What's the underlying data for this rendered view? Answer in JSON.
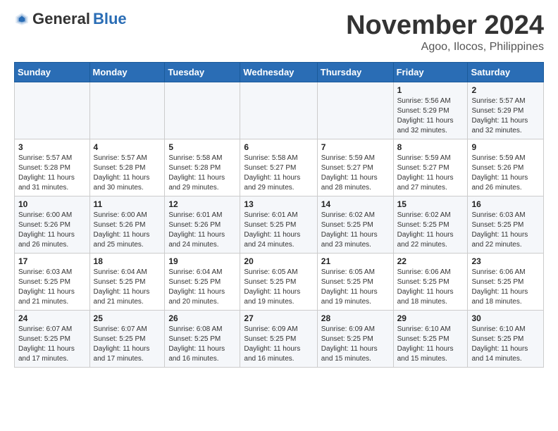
{
  "header": {
    "logo_general": "General",
    "logo_blue": "Blue",
    "month_title": "November 2024",
    "location": "Agoo, Ilocos, Philippines"
  },
  "weekdays": [
    "Sunday",
    "Monday",
    "Tuesday",
    "Wednesday",
    "Thursday",
    "Friday",
    "Saturday"
  ],
  "weeks": [
    [
      {
        "day": "",
        "info": ""
      },
      {
        "day": "",
        "info": ""
      },
      {
        "day": "",
        "info": ""
      },
      {
        "day": "",
        "info": ""
      },
      {
        "day": "",
        "info": ""
      },
      {
        "day": "1",
        "info": "Sunrise: 5:56 AM\nSunset: 5:29 PM\nDaylight: 11 hours and 32 minutes."
      },
      {
        "day": "2",
        "info": "Sunrise: 5:57 AM\nSunset: 5:29 PM\nDaylight: 11 hours and 32 minutes."
      }
    ],
    [
      {
        "day": "3",
        "info": "Sunrise: 5:57 AM\nSunset: 5:28 PM\nDaylight: 11 hours and 31 minutes."
      },
      {
        "day": "4",
        "info": "Sunrise: 5:57 AM\nSunset: 5:28 PM\nDaylight: 11 hours and 30 minutes."
      },
      {
        "day": "5",
        "info": "Sunrise: 5:58 AM\nSunset: 5:28 PM\nDaylight: 11 hours and 29 minutes."
      },
      {
        "day": "6",
        "info": "Sunrise: 5:58 AM\nSunset: 5:27 PM\nDaylight: 11 hours and 29 minutes."
      },
      {
        "day": "7",
        "info": "Sunrise: 5:59 AM\nSunset: 5:27 PM\nDaylight: 11 hours and 28 minutes."
      },
      {
        "day": "8",
        "info": "Sunrise: 5:59 AM\nSunset: 5:27 PM\nDaylight: 11 hours and 27 minutes."
      },
      {
        "day": "9",
        "info": "Sunrise: 5:59 AM\nSunset: 5:26 PM\nDaylight: 11 hours and 26 minutes."
      }
    ],
    [
      {
        "day": "10",
        "info": "Sunrise: 6:00 AM\nSunset: 5:26 PM\nDaylight: 11 hours and 26 minutes."
      },
      {
        "day": "11",
        "info": "Sunrise: 6:00 AM\nSunset: 5:26 PM\nDaylight: 11 hours and 25 minutes."
      },
      {
        "day": "12",
        "info": "Sunrise: 6:01 AM\nSunset: 5:26 PM\nDaylight: 11 hours and 24 minutes."
      },
      {
        "day": "13",
        "info": "Sunrise: 6:01 AM\nSunset: 5:25 PM\nDaylight: 11 hours and 24 minutes."
      },
      {
        "day": "14",
        "info": "Sunrise: 6:02 AM\nSunset: 5:25 PM\nDaylight: 11 hours and 23 minutes."
      },
      {
        "day": "15",
        "info": "Sunrise: 6:02 AM\nSunset: 5:25 PM\nDaylight: 11 hours and 22 minutes."
      },
      {
        "day": "16",
        "info": "Sunrise: 6:03 AM\nSunset: 5:25 PM\nDaylight: 11 hours and 22 minutes."
      }
    ],
    [
      {
        "day": "17",
        "info": "Sunrise: 6:03 AM\nSunset: 5:25 PM\nDaylight: 11 hours and 21 minutes."
      },
      {
        "day": "18",
        "info": "Sunrise: 6:04 AM\nSunset: 5:25 PM\nDaylight: 11 hours and 21 minutes."
      },
      {
        "day": "19",
        "info": "Sunrise: 6:04 AM\nSunset: 5:25 PM\nDaylight: 11 hours and 20 minutes."
      },
      {
        "day": "20",
        "info": "Sunrise: 6:05 AM\nSunset: 5:25 PM\nDaylight: 11 hours and 19 minutes."
      },
      {
        "day": "21",
        "info": "Sunrise: 6:05 AM\nSunset: 5:25 PM\nDaylight: 11 hours and 19 minutes."
      },
      {
        "day": "22",
        "info": "Sunrise: 6:06 AM\nSunset: 5:25 PM\nDaylight: 11 hours and 18 minutes."
      },
      {
        "day": "23",
        "info": "Sunrise: 6:06 AM\nSunset: 5:25 PM\nDaylight: 11 hours and 18 minutes."
      }
    ],
    [
      {
        "day": "24",
        "info": "Sunrise: 6:07 AM\nSunset: 5:25 PM\nDaylight: 11 hours and 17 minutes."
      },
      {
        "day": "25",
        "info": "Sunrise: 6:07 AM\nSunset: 5:25 PM\nDaylight: 11 hours and 17 minutes."
      },
      {
        "day": "26",
        "info": "Sunrise: 6:08 AM\nSunset: 5:25 PM\nDaylight: 11 hours and 16 minutes."
      },
      {
        "day": "27",
        "info": "Sunrise: 6:09 AM\nSunset: 5:25 PM\nDaylight: 11 hours and 16 minutes."
      },
      {
        "day": "28",
        "info": "Sunrise: 6:09 AM\nSunset: 5:25 PM\nDaylight: 11 hours and 15 minutes."
      },
      {
        "day": "29",
        "info": "Sunrise: 6:10 AM\nSunset: 5:25 PM\nDaylight: 11 hours and 15 minutes."
      },
      {
        "day": "30",
        "info": "Sunrise: 6:10 AM\nSunset: 5:25 PM\nDaylight: 11 hours and 14 minutes."
      }
    ]
  ]
}
